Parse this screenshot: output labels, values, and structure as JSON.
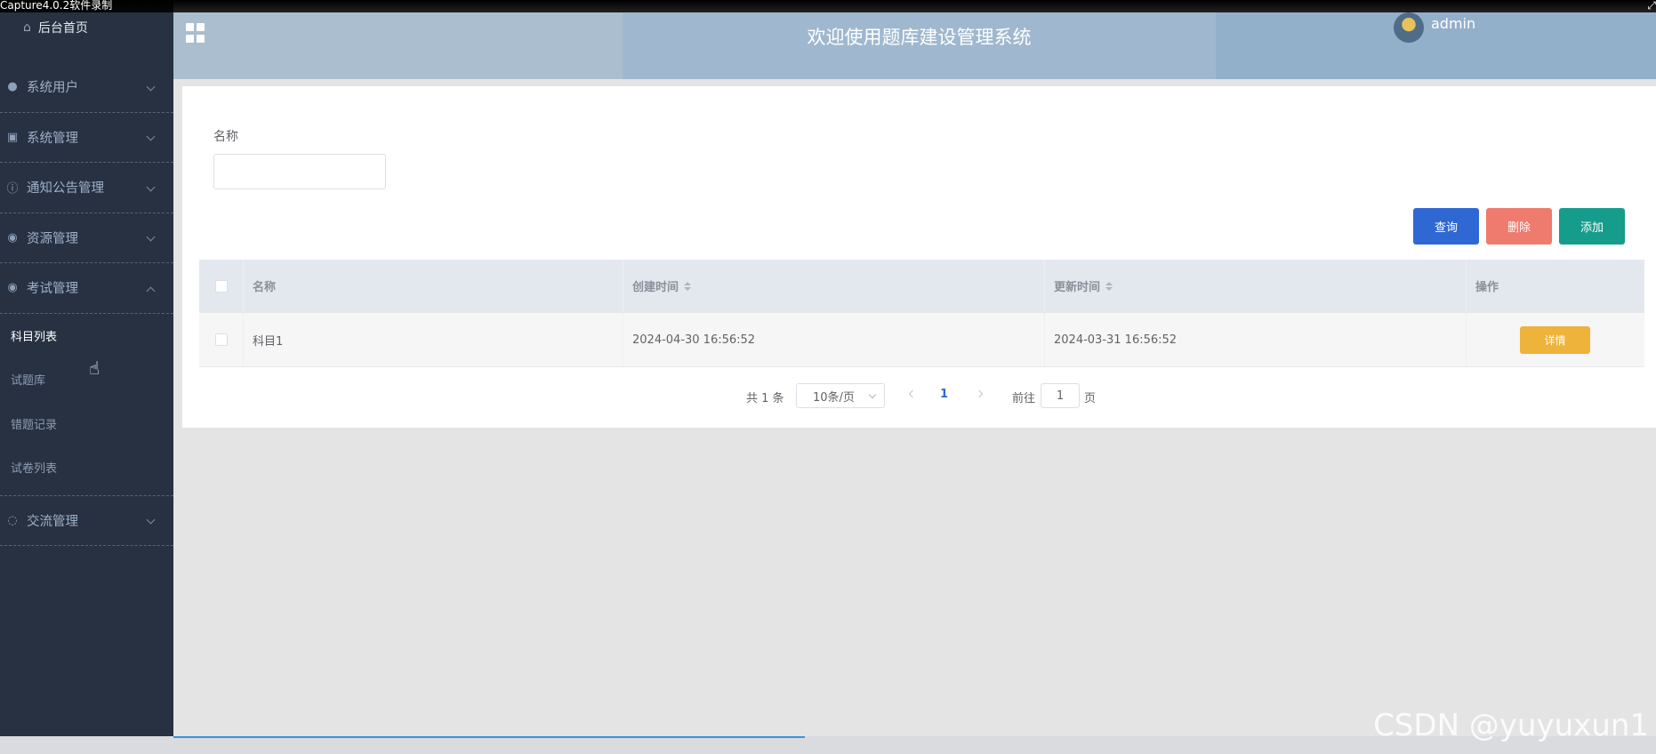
{
  "recorder": {
    "title": "Capture4.0.2软件录制"
  },
  "sidebar": {
    "home_label": "后台首页",
    "menu": [
      {
        "label": "系统用户",
        "icon": "user-icon",
        "expanded": false
      },
      {
        "label": "系统管理",
        "icon": "image-icon",
        "expanded": false
      },
      {
        "label": "通知公告管理",
        "icon": "info-icon",
        "expanded": false
      },
      {
        "label": "资源管理",
        "icon": "bulb-icon",
        "expanded": false
      },
      {
        "label": "考试管理",
        "icon": "bulb-icon",
        "expanded": true
      }
    ],
    "submenu": [
      {
        "label": "科目列表",
        "active": true
      },
      {
        "label": "试题库",
        "active": false
      },
      {
        "label": "错题记录",
        "active": false
      },
      {
        "label": "试卷列表",
        "active": false
      }
    ],
    "last_menu": {
      "label": "交流管理",
      "icon": "chat-icon"
    }
  },
  "header": {
    "title": "欢迎使用题库建设管理系统",
    "username": "admin"
  },
  "search": {
    "name_label": "名称",
    "name_value": ""
  },
  "actions": {
    "query": "查询",
    "delete": "删除",
    "add": "添加"
  },
  "table": {
    "columns": [
      "名称",
      "创建时间",
      "更新时间",
      "操作"
    ],
    "rows": [
      {
        "name": "科目1",
        "created": "2024-04-30 16:56:52",
        "updated": "2024-03-31 16:56:52",
        "action": "详情"
      }
    ]
  },
  "pagination": {
    "total_text": "共 1 条",
    "page_size": "10条/页",
    "current": "1",
    "goto_label": "前往",
    "goto_value": "1",
    "goto_unit": "页"
  },
  "watermark": "CSDN @yuyuxun1",
  "colors": {
    "sidebar_bg": "#273142",
    "header_bg": "#abbecf",
    "query_button": "#2f68d2",
    "delete_button": "#ef7a6e",
    "add_button": "#159c8b",
    "detail_button": "#eeb33a"
  }
}
